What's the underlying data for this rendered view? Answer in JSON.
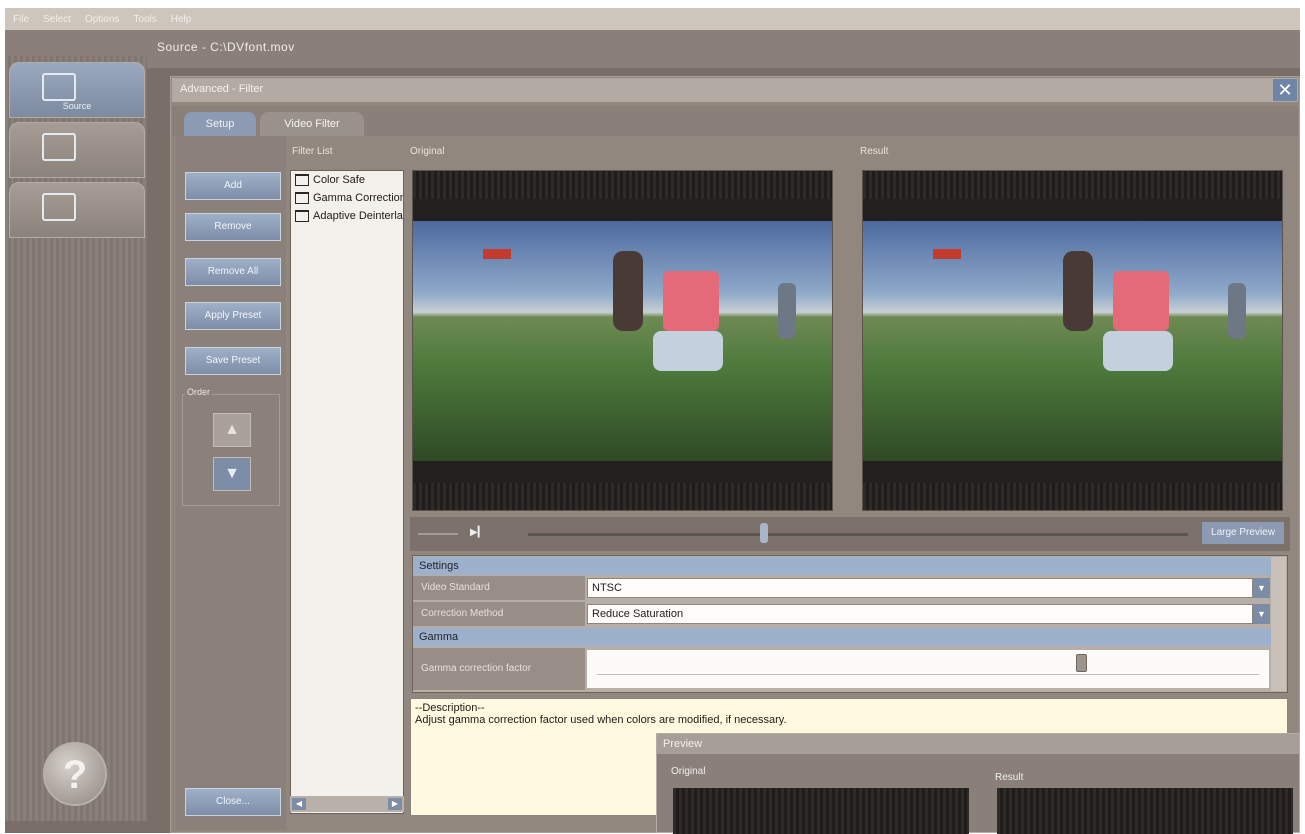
{
  "menu": [
    "File",
    "Select",
    "Options",
    "Tools",
    "Help"
  ],
  "window_title": "Source - C:\\DVfont.mov",
  "nav": [
    {
      "label": "Source",
      "icon": "source-icon"
    },
    {
      "label": "",
      "icon": "edit-icon"
    },
    {
      "label": "",
      "icon": "output-icon"
    }
  ],
  "dialog": {
    "title": "Advanced - Filter",
    "tabs": [
      "Setup",
      "Video Filter"
    ]
  },
  "buttons": {
    "add": "Add",
    "remove": "Remove",
    "remove_all": "Remove All",
    "apply_preset": "Apply Preset",
    "save_preset": "Save Preset",
    "order": "Order",
    "close": "Close..."
  },
  "filter_list": {
    "label": "Filter List",
    "items": [
      "Color Safe",
      "Gamma Correction",
      "Adaptive Deinterlace"
    ]
  },
  "preview": {
    "original_label": "Original",
    "result_label": "Result",
    "large_preview": "Large Preview"
  },
  "settings": {
    "header": "Settings",
    "video_standard_label": "Video Standard",
    "video_standard_value": "NTSC",
    "correction_method_label": "Correction Method",
    "correction_method_value": "Reduce Saturation",
    "gamma_header": "Gamma",
    "gamma_label": "Gamma correction factor",
    "gamma_level": 0.73
  },
  "description": {
    "label": "--Description--",
    "text": "Adjust gamma correction factor used when colors are modified, if necessary."
  },
  "float_preview": {
    "title": "Preview",
    "original_label": "Original",
    "result_label": "Result"
  },
  "colors": {
    "accent_blue": "#7d8da7",
    "panel": "#8b817a",
    "desc_bg": "#fff9e0"
  }
}
